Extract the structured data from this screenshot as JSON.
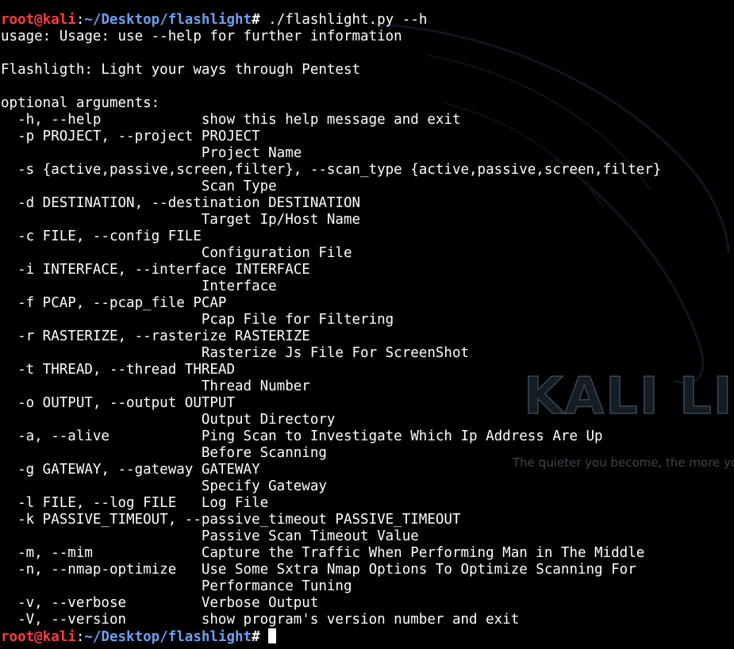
{
  "watermark": {
    "logo_text": "KALI LIN",
    "tagline": "The quieter you become, the more you"
  },
  "prompt": {
    "user_host": "root@kali",
    "separator": ":",
    "path": "~/Desktop/flashlight",
    "symbol": "# "
  },
  "first_command": "./flashlight.py --h",
  "output_lines": [
    "usage: Usage: use --help for further information",
    "",
    "Flashligth: Light your ways through Pentest",
    "",
    "optional arguments:",
    "  -h, --help            show this help message and exit",
    "  -p PROJECT, --project PROJECT",
    "                        Project Name",
    "  -s {active,passive,screen,filter}, --scan_type {active,passive,screen,filter}",
    "                        Scan Type",
    "  -d DESTINATION, --destination DESTINATION",
    "                        Target Ip/Host Name",
    "  -c FILE, --config FILE",
    "                        Configuration File",
    "  -i INTERFACE, --interface INTERFACE",
    "                        Interface",
    "  -f PCAP, --pcap_file PCAP",
    "                        Pcap File for Filtering",
    "  -r RASTERIZE, --rasterize RASTERIZE",
    "                        Rasterize Js File For ScreenShot",
    "  -t THREAD, --thread THREAD",
    "                        Thread Number",
    "  -o OUTPUT, --output OUTPUT",
    "                        Output Directory",
    "  -a, --alive           Ping Scan to Investigate Which Ip Address Are Up",
    "                        Before Scanning",
    "  -g GATEWAY, --gateway GATEWAY",
    "                        Specify Gateway",
    "  -l FILE, --log FILE   Log File",
    "  -k PASSIVE_TIMEOUT, --passive_timeout PASSIVE_TIMEOUT",
    "                        Passive Scan Timeout Value",
    "  -m, --mim             Capture the Traffic When Performing Man in The Middle",
    "  -n, --nmap-optimize   Use Some Sxtra Nmap Options To Optimize Scanning For",
    "                        Performance Tuning",
    "  -v, --verbose         Verbose Output",
    "  -V, --version         show program's version number and exit"
  ]
}
